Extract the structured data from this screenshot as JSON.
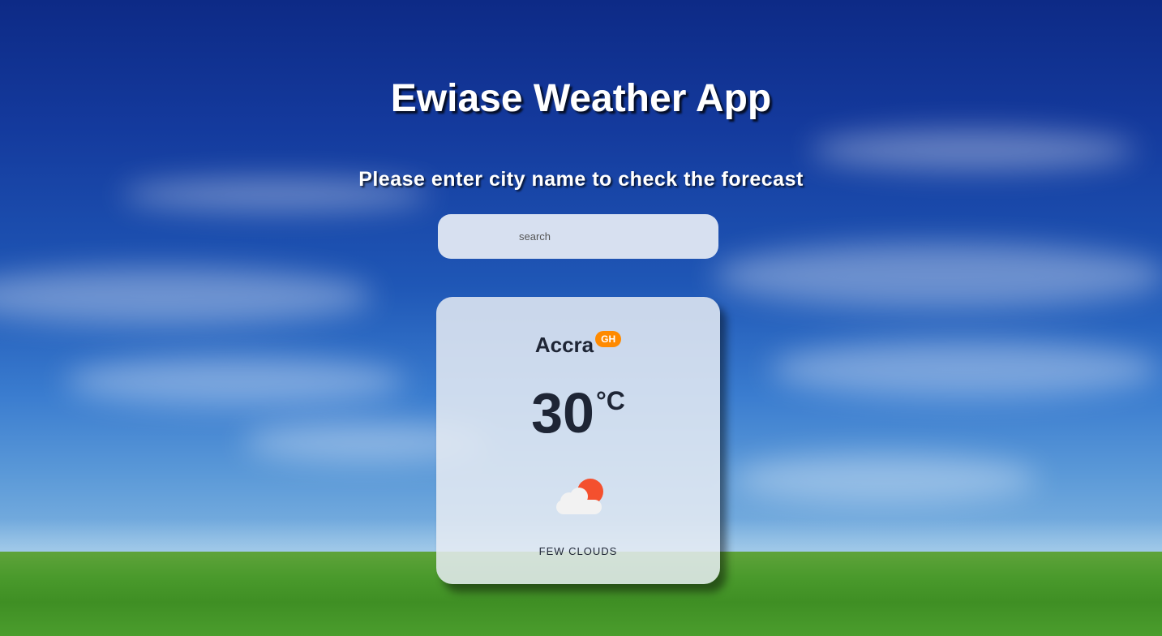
{
  "app": {
    "title": "Ewiase Weather App",
    "prompt": "Please enter city name to check the forecast"
  },
  "search": {
    "placeholder": "search",
    "value": ""
  },
  "weather": {
    "city": "Accra",
    "country_code": "GH",
    "temperature": "30",
    "unit": "°C",
    "condition": "FEW CLOUDS",
    "icon": "few-clouds-day-icon"
  },
  "colors": {
    "badge": "#ff8a00",
    "sun": "#f4502e",
    "text_dark": "#1e2535"
  }
}
